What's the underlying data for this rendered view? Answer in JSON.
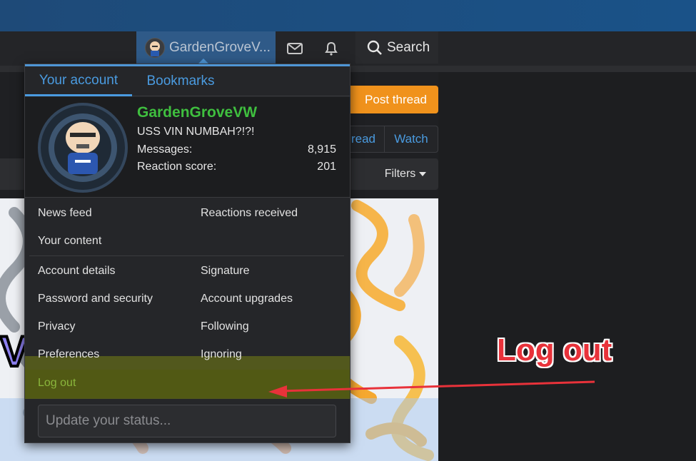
{
  "header": {
    "account_name": "GardenGroveV...",
    "search_label": "Search"
  },
  "page": {
    "post_thread_label": "Post thread",
    "unwatch_fragment": "read",
    "watch_label": "Watch",
    "filters_label": "Filters"
  },
  "menu": {
    "tabs": [
      {
        "label": "Your account",
        "active": true
      },
      {
        "label": "Bookmarks",
        "active": false
      }
    ],
    "profile": {
      "username": "GardenGroveVW",
      "user_title": "USS VIN NUMBAH?!?!",
      "messages_label": "Messages:",
      "messages_value": "8,915",
      "reaction_label": "Reaction score:",
      "reaction_value": "201"
    },
    "links_group1": {
      "news_feed": "News feed",
      "reactions_received": "Reactions received",
      "your_content": "Your content"
    },
    "links_group2": {
      "account_details": "Account details",
      "signature": "Signature",
      "password_security": "Password and security",
      "account_upgrades": "Account upgrades",
      "privacy": "Privacy",
      "following": "Following",
      "preferences": "Preferences",
      "ignoring": "Ignoring"
    },
    "logout_label": "Log out",
    "status_placeholder": "Update your status..."
  },
  "annotation": {
    "text": "Log out",
    "color": "#e8323a"
  },
  "colors": {
    "accent": "#4a9be0",
    "username_green": "#3fbf3f",
    "post_thread_orange": "#f0921c"
  }
}
